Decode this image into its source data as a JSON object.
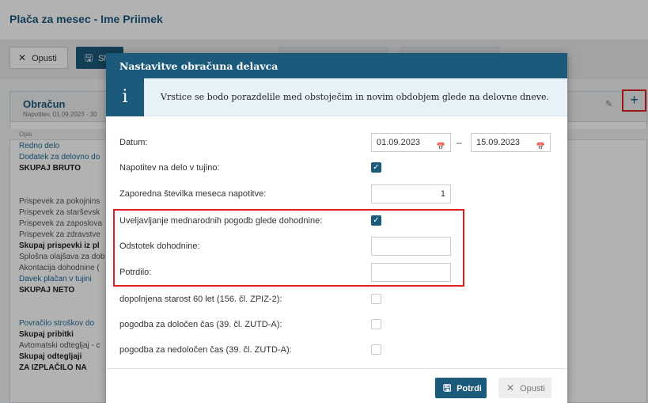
{
  "page": {
    "title": "Plača za mesec - Ime Priimek"
  },
  "toolbar": {
    "cancel_label": "Opusti",
    "save_label": "Sh"
  },
  "card": {
    "title": "Obračun",
    "subtitle": "Napotitev, 01.09.2023 - 30",
    "column_header": "Opis",
    "rows": [
      {
        "label": "Redno delo",
        "style": "link"
      },
      {
        "label": "Dodatek za delovno do",
        "style": "link"
      },
      {
        "label": "SKUPAJ BRUTO",
        "style": "bold"
      },
      {
        "label": "Prispevek za pokojnins",
        "style": "plain"
      },
      {
        "label": "Prispevek za starševsk",
        "style": "plain"
      },
      {
        "label": "Prispevek za zaposlova",
        "style": "plain"
      },
      {
        "label": "Prispevek za zdravstve",
        "style": "plain"
      },
      {
        "label": "Skupaj prispevki iz pl",
        "style": "bold"
      },
      {
        "label": "Splošna olajšava za dob",
        "style": "plain"
      },
      {
        "label": "Akontacija dohodnine (",
        "style": "plain"
      },
      {
        "label": "Davek plačan v tujini",
        "style": "link"
      },
      {
        "label": "SKUPAJ NETO",
        "style": "bold"
      },
      {
        "label": "Povračilo stroškov do",
        "style": "link"
      },
      {
        "label": "Skupaj pribitki",
        "style": "bold"
      },
      {
        "label": "Avtomatski odtegljaj - c",
        "style": "plain"
      },
      {
        "label": "Skupaj odtegljaji",
        "style": "bold"
      },
      {
        "label": "ZA IZPLAČILO NA",
        "style": "bold"
      }
    ]
  },
  "modal": {
    "title": "Nastavitve obračuna delavca",
    "info_icon": "i",
    "info_text": "Vrstice se bodo porazdelile med obstoječim in novim obdobjem glede na delovne dneve.",
    "fields": {
      "date_label": "Datum:",
      "date_from": "01.09.2023",
      "date_to": "15.09.2023",
      "date_separator": "–",
      "posting_abroad_label": "Napotitev na delo v tujino:",
      "posting_abroad_checked": true,
      "month_number_label": "Zaporedna številka meseca napotitve:",
      "month_number_value": "1",
      "treaty_label": "Uveljavljanje mednarodnih pogodb glede dohodnine:",
      "treaty_checked": true,
      "income_tax_percent_label": "Odstotek dohodnine:",
      "income_tax_percent_value": "",
      "certificate_label": "Potrdilo:",
      "certificate_value": "",
      "age60_label": "dopolnjena starost 60 let (156. čl. ZPIZ-2):",
      "age60_checked": false,
      "fixed_term_label": "pogodba za določen čas (39. čl. ZUTD-A):",
      "fixed_term_checked": false,
      "indefinite_label": "pogodba za nedoločen čas (39. čl. ZUTD-A):",
      "indefinite_checked": false
    },
    "confirm_label": "Potrdi",
    "cancel_label": "Opusti"
  },
  "icons": {
    "cancel": "close-icon",
    "save": "save-icon",
    "edit": "pencil-icon",
    "add": "plus-icon",
    "calendar": "calendar-icon",
    "check": "check-icon"
  },
  "colors": {
    "brand": "#1b5a7b",
    "highlight": "#e02020",
    "info_bg": "#e7f1f8"
  }
}
